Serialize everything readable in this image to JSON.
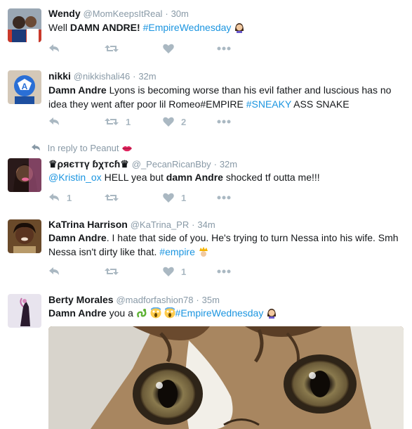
{
  "tweets": [
    {
      "name": "Wendy",
      "handle": "@MomKeepsItReal",
      "sep": "·",
      "time": "30m",
      "text": {
        "a": "Well ",
        "b": "DAMN ANDRE",
        "c": "! ",
        "tag": "#EmpireWednesday"
      },
      "counts": {
        "retweet": "",
        "like": ""
      }
    },
    {
      "name": "nikki",
      "handle": "@nikkishali46",
      "sep": "·",
      "time": "32m",
      "text": {
        "b": "Damn Andre",
        "a": " Lyons is becoming worse than his evil father and luscious has no idea they went after poor lil Romeo#EMPIRE ",
        "tag": "#SNEAKY",
        "c": " ASS SNAKE"
      },
      "counts": {
        "retweet": "1",
        "like": "2"
      }
    },
    {
      "context": "In reply to Peanut",
      "name": "♛ρяєттү ɓχтcɦ♛",
      "handle": "@_PecanRicanBby",
      "sep": "·",
      "time": "32m",
      "text": {
        "mention": "@Kristin_ox",
        "a": " HELL yea but ",
        "b": "damn Andre",
        "c": " shocked tf outta me!!!"
      },
      "counts": {
        "reply": "1",
        "retweet": "",
        "like": "1"
      }
    },
    {
      "name": "KaTrina Harrison",
      "handle": "@KaTrina_PR",
      "sep": "·",
      "time": "34m",
      "text": {
        "b": "Damn Andre",
        "a": ". I hate that side of you. He's trying to turn Nessa into his wife. Smh Nessa isn't dirty like that. ",
        "tag": "#empire"
      },
      "counts": {
        "retweet": "",
        "like": "1"
      }
    },
    {
      "name": "Berty Morales",
      "handle": "@madforfashion78",
      "sep": "·",
      "time": "35m",
      "text": {
        "b": "Damn Andre",
        "a": " you a ",
        "tag": "#EmpireWednesday"
      }
    }
  ],
  "icons": [
    "reply-icon",
    "retweet-icon",
    "like-icon",
    "more-icon"
  ],
  "colors": {
    "link": "#1b95e0",
    "meta": "#8899a6",
    "action": "#aab8c2",
    "border": "#e1e8ed"
  }
}
